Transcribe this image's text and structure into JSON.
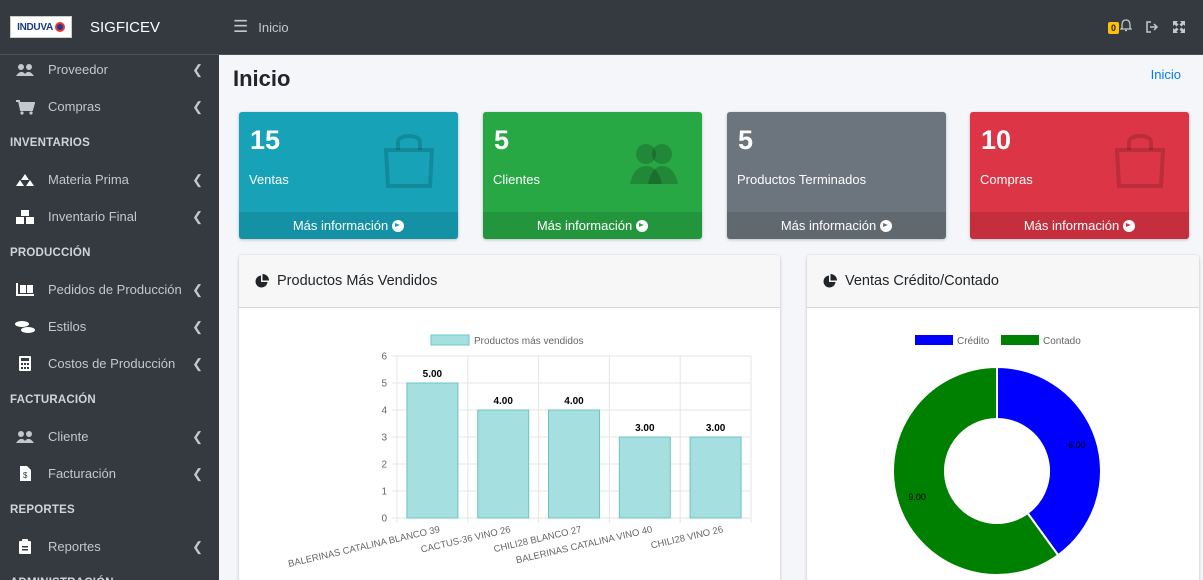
{
  "brand": {
    "logo_text": "INDUVA",
    "app_name": "SIGFICEV"
  },
  "topnav": {
    "home_link": "Inicio",
    "notification_count": "0"
  },
  "sidebar": {
    "items": [
      {
        "label": "Proveedor",
        "icon": "people-icon",
        "type": "item"
      },
      {
        "label": "Compras",
        "icon": "cart-icon",
        "type": "item"
      },
      {
        "label": "INVENTARIOS",
        "type": "header"
      },
      {
        "label": "Materia Prima",
        "icon": "cubes-icon",
        "type": "item"
      },
      {
        "label": "Inventario Final",
        "icon": "boxes-icon",
        "type": "item"
      },
      {
        "label": "PRODUCCIÓN",
        "type": "header"
      },
      {
        "label": "Pedidos de Producción",
        "icon": "dolly-icon",
        "type": "item"
      },
      {
        "label": "Estilos",
        "icon": "shoe-prints-icon",
        "type": "item"
      },
      {
        "label": "Costos de Producción",
        "icon": "calculator-icon",
        "type": "item"
      },
      {
        "label": "FACTURACIÓN",
        "type": "header"
      },
      {
        "label": "Cliente",
        "icon": "people-icon",
        "type": "item"
      },
      {
        "label": "Facturación",
        "icon": "invoice-icon",
        "type": "item"
      },
      {
        "label": "REPORTES",
        "type": "header"
      },
      {
        "label": "Reportes",
        "icon": "report-icon",
        "type": "item"
      },
      {
        "label": "ADMINISTRACIÓN",
        "type": "header"
      }
    ]
  },
  "page": {
    "title": "Inicio",
    "breadcrumb": "Inicio"
  },
  "boxes": [
    {
      "value": "15",
      "label": "Ventas",
      "footer": "Más información",
      "color": "#17a2b8",
      "icon": "shopping-bag-icon"
    },
    {
      "value": "5",
      "label": "Clientes",
      "footer": "Más información",
      "color": "#28a745",
      "icon": "users-icon"
    },
    {
      "value": "5",
      "label": "Productos Terminados",
      "footer": "Más información",
      "color": "#6c757d",
      "icon": ""
    },
    {
      "value": "10",
      "label": "Compras",
      "footer": "Más información",
      "color": "#dc3545",
      "icon": "shopping-bag-icon"
    }
  ],
  "cards": {
    "bar_title": "Productos Más Vendidos",
    "donut_title": "Ventas Crédito/Contado"
  },
  "chart_data": [
    {
      "type": "bar",
      "title": "",
      "series": [
        {
          "name": "Productos más vendidos",
          "values": [
            5,
            4,
            4,
            3,
            3
          ],
          "value_labels": [
            "5.00",
            "4.00",
            "4.00",
            "3.00",
            "3.00"
          ]
        }
      ],
      "categories": [
        "BALERINAS CATALINA BLANCO 39",
        "CACTUS-36 VINO 26",
        "CHILI28 BLANCO 27",
        "BALERINAS CATALINA VINO 40",
        "CHILI28 VINO 26"
      ],
      "yticks": [
        "0",
        "1",
        "2",
        "3",
        "4",
        "5",
        "6"
      ],
      "ylim": [
        0,
        6
      ],
      "legend": "top",
      "grid": true,
      "bar_fill": "#a6dfdf",
      "bar_stroke": "#6cc4c4"
    },
    {
      "type": "pie",
      "variant": "doughnut",
      "labels": [
        "Crédito",
        "Contado"
      ],
      "values": [
        6,
        9
      ],
      "value_labels": [
        "6.00",
        "9.00"
      ],
      "colors": [
        "#0000ff",
        "#008000"
      ],
      "legend": "top"
    }
  ]
}
